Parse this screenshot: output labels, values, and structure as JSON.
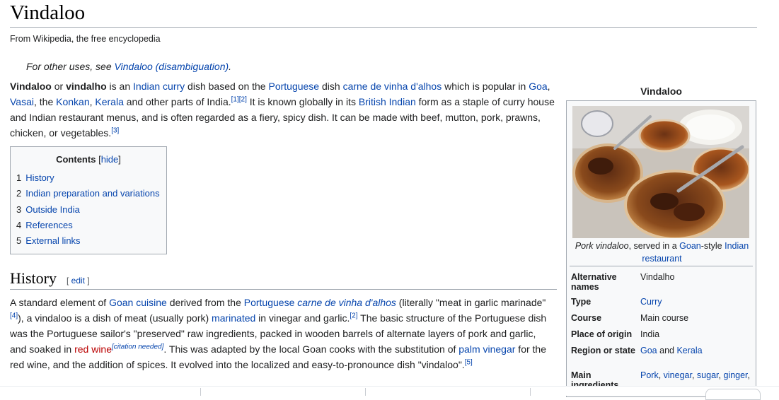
{
  "title": "Vindaloo",
  "tagline": "From Wikipedia, the free encyclopedia",
  "hatnote": {
    "prefix": "For other uses, see ",
    "link": "Vindaloo (disambiguation)",
    "suffix": "."
  },
  "intro": {
    "b1": "Vindaloo",
    "t1": " or ",
    "b2": "vindalho",
    "t2": " is an ",
    "l1": "Indian curry",
    "t3": " dish based on the ",
    "l2": "Portuguese",
    "t4": " dish ",
    "l3": "carne de vinha d'alhos",
    "t5": " which is popular in ",
    "l4": "Goa",
    "t6": ", ",
    "l5": "Vasai",
    "t7": ", the ",
    "l6": "Konkan",
    "t8": ", ",
    "l7": "Kerala",
    "t9": " and other parts of India.",
    "r1": "[1]",
    "r2": "[2]",
    "t10": " It is known globally in its ",
    "l8": "British Indian",
    "t11": " form as a staple of curry house and Indian restaurant menus, and is often regarded as a fiery, spicy dish. It can be made with beef, mutton, pork, prawns, chicken, or vegetables.",
    "r3": "[3]"
  },
  "toc": {
    "title": "Contents",
    "hide_open": "[",
    "hide": "hide",
    "hide_close": "]",
    "items": [
      {
        "num": "1",
        "label": "History"
      },
      {
        "num": "2",
        "label": "Indian preparation and variations"
      },
      {
        "num": "3",
        "label": "Outside India"
      },
      {
        "num": "4",
        "label": "References"
      },
      {
        "num": "5",
        "label": "External links"
      }
    ]
  },
  "history": {
    "heading": "History",
    "edit_open": "[ ",
    "edit": "edit",
    "edit_close": " ]",
    "t1": "A standard element of ",
    "l1": "Goan cuisine",
    "t2": " derived from the ",
    "l2": "Portuguese",
    "t3": " ",
    "l3": "carne de vinha d'alhos",
    "t4": " (literally \"meat in garlic marinade\"",
    "r4": "[4]",
    "t5": "), a vindaloo is a dish of meat (usually pork) ",
    "l4": "marinated",
    "t6": " in vinegar and garlic.",
    "r2": "[2]",
    "t7": " The basic structure of the Portuguese dish was the Portuguese sailor's \"preserved\" raw ingredients, packed in wooden barrels of alternate layers of pork and garlic, and soaked in ",
    "l5": "red wine",
    "cn": "[citation needed]",
    "t8": ". This was adapted by the local Goan cooks with the substitution of ",
    "l6": "palm vinegar",
    "t9": " for the red wine, and the addition of spices. It evolved into the localized and easy-to-pronounce dish \"vindaloo\".",
    "r5": "[5]"
  },
  "infobox": {
    "title": "Vindaloo",
    "caption": {
      "t1": "Pork vindaloo",
      "t2": ", served in a ",
      "l1": "Goan",
      "t3": "-style ",
      "l2": "Indian restaurant"
    },
    "rows": {
      "alt": {
        "label": "Alternative names",
        "value": "Vindalho"
      },
      "type": {
        "label": "Type",
        "value": "Curry"
      },
      "course": {
        "label": "Course",
        "value": "Main course"
      },
      "origin": {
        "label": "Place of origin",
        "value": "India"
      },
      "region": {
        "label": "Region or state",
        "v1": "Goa",
        "v2": " and ",
        "v3": "Kerala"
      },
      "ingredients": {
        "label": "Main ingredients",
        "v1": "Pork",
        "s1": ", ",
        "v2": "vinegar",
        "s2": ", ",
        "v3": "sugar",
        "s3": ", ",
        "v4": "ginger",
        "s4": ","
      }
    }
  },
  "colors": {
    "link": "#0645ad",
    "redlink": "#ba0000",
    "border": "#a2a9b1",
    "infobox_bg": "#f8f9fa"
  }
}
